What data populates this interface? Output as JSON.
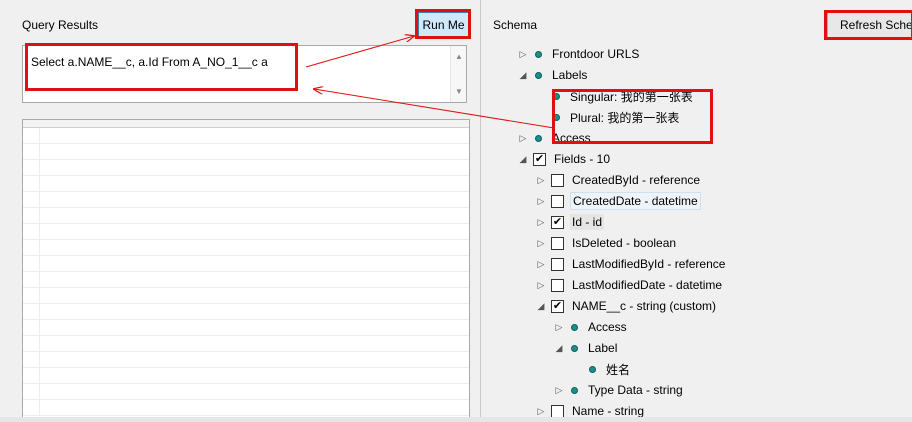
{
  "query_panel": {
    "title": "Query Results",
    "run_button": "Run Me",
    "query_text": "Select a.NAME__c, a.Id From A_NO_1__c a"
  },
  "schema_panel": {
    "title": "Schema",
    "refresh_button": "Refresh Schema",
    "tree": [
      {
        "id": "frontdoor",
        "label": "Frontdoor URLS",
        "kind": "dot",
        "arrow": "collapsed"
      },
      {
        "id": "labels",
        "label": "Labels",
        "kind": "dot",
        "arrow": "expanded"
      },
      {
        "id": "singular",
        "label": "Singular: 我的第一张表",
        "kind": "dot",
        "arrow": "none"
      },
      {
        "id": "plural",
        "label": "Plural: 我的第一张表",
        "kind": "dot",
        "arrow": "none"
      },
      {
        "id": "access",
        "label": "Access",
        "kind": "dot",
        "arrow": "collapsed"
      },
      {
        "id": "fields",
        "label": "Fields - 10",
        "kind": "check",
        "checked": true,
        "arrow": "expanded"
      },
      {
        "id": "createdbyid",
        "label": "CreatedById - reference",
        "kind": "check",
        "checked": false,
        "arrow": "collapsed"
      },
      {
        "id": "createddate",
        "label": "CreatedDate - datetime",
        "kind": "check",
        "checked": false,
        "arrow": "collapsed"
      },
      {
        "id": "id",
        "label": "Id - id",
        "kind": "check",
        "checked": true,
        "arrow": "collapsed"
      },
      {
        "id": "isdeleted",
        "label": "IsDeleted - boolean",
        "kind": "check",
        "checked": false,
        "arrow": "collapsed"
      },
      {
        "id": "lastmodifiedbyid",
        "label": "LastModifiedById - reference",
        "kind": "check",
        "checked": false,
        "arrow": "collapsed"
      },
      {
        "id": "lastmodifieddate",
        "label": "LastModifiedDate - datetime",
        "kind": "check",
        "checked": false,
        "arrow": "collapsed"
      },
      {
        "id": "name_c",
        "label": "NAME__c - string (custom)",
        "kind": "check",
        "checked": true,
        "arrow": "expanded"
      },
      {
        "id": "name_access",
        "label": "Access",
        "kind": "dot",
        "arrow": "collapsed"
      },
      {
        "id": "name_label",
        "label": "Label",
        "kind": "dot",
        "arrow": "expanded"
      },
      {
        "id": "name_label_value",
        "label": "姓名",
        "kind": "dot",
        "arrow": "none"
      },
      {
        "id": "name_typedata",
        "label": "Type Data - string",
        "kind": "dot",
        "arrow": "collapsed"
      },
      {
        "id": "name",
        "label": "Name - string",
        "kind": "check",
        "checked": false,
        "arrow": "collapsed"
      }
    ]
  }
}
